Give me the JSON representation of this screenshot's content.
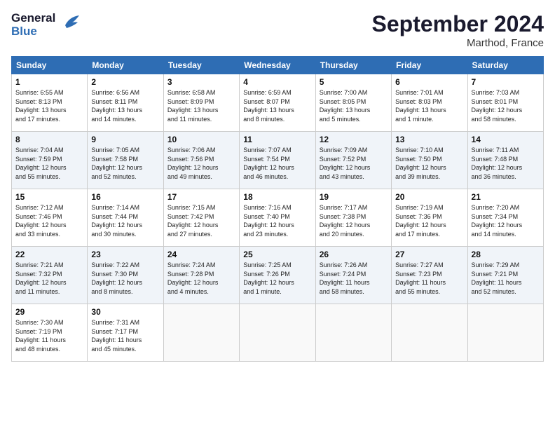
{
  "header": {
    "logo_line1": "General",
    "logo_line2": "Blue",
    "month_title": "September 2024",
    "location": "Marthod, France"
  },
  "weekdays": [
    "Sunday",
    "Monday",
    "Tuesday",
    "Wednesday",
    "Thursday",
    "Friday",
    "Saturday"
  ],
  "weeks": [
    [
      {
        "day": "1",
        "info": "Sunrise: 6:55 AM\nSunset: 8:13 PM\nDaylight: 13 hours\nand 17 minutes."
      },
      {
        "day": "2",
        "info": "Sunrise: 6:56 AM\nSunset: 8:11 PM\nDaylight: 13 hours\nand 14 minutes."
      },
      {
        "day": "3",
        "info": "Sunrise: 6:58 AM\nSunset: 8:09 PM\nDaylight: 13 hours\nand 11 minutes."
      },
      {
        "day": "4",
        "info": "Sunrise: 6:59 AM\nSunset: 8:07 PM\nDaylight: 13 hours\nand 8 minutes."
      },
      {
        "day": "5",
        "info": "Sunrise: 7:00 AM\nSunset: 8:05 PM\nDaylight: 13 hours\nand 5 minutes."
      },
      {
        "day": "6",
        "info": "Sunrise: 7:01 AM\nSunset: 8:03 PM\nDaylight: 13 hours\nand 1 minute."
      },
      {
        "day": "7",
        "info": "Sunrise: 7:03 AM\nSunset: 8:01 PM\nDaylight: 12 hours\nand 58 minutes."
      }
    ],
    [
      {
        "day": "8",
        "info": "Sunrise: 7:04 AM\nSunset: 7:59 PM\nDaylight: 12 hours\nand 55 minutes."
      },
      {
        "day": "9",
        "info": "Sunrise: 7:05 AM\nSunset: 7:58 PM\nDaylight: 12 hours\nand 52 minutes."
      },
      {
        "day": "10",
        "info": "Sunrise: 7:06 AM\nSunset: 7:56 PM\nDaylight: 12 hours\nand 49 minutes."
      },
      {
        "day": "11",
        "info": "Sunrise: 7:07 AM\nSunset: 7:54 PM\nDaylight: 12 hours\nand 46 minutes."
      },
      {
        "day": "12",
        "info": "Sunrise: 7:09 AM\nSunset: 7:52 PM\nDaylight: 12 hours\nand 43 minutes."
      },
      {
        "day": "13",
        "info": "Sunrise: 7:10 AM\nSunset: 7:50 PM\nDaylight: 12 hours\nand 39 minutes."
      },
      {
        "day": "14",
        "info": "Sunrise: 7:11 AM\nSunset: 7:48 PM\nDaylight: 12 hours\nand 36 minutes."
      }
    ],
    [
      {
        "day": "15",
        "info": "Sunrise: 7:12 AM\nSunset: 7:46 PM\nDaylight: 12 hours\nand 33 minutes."
      },
      {
        "day": "16",
        "info": "Sunrise: 7:14 AM\nSunset: 7:44 PM\nDaylight: 12 hours\nand 30 minutes."
      },
      {
        "day": "17",
        "info": "Sunrise: 7:15 AM\nSunset: 7:42 PM\nDaylight: 12 hours\nand 27 minutes."
      },
      {
        "day": "18",
        "info": "Sunrise: 7:16 AM\nSunset: 7:40 PM\nDaylight: 12 hours\nand 23 minutes."
      },
      {
        "day": "19",
        "info": "Sunrise: 7:17 AM\nSunset: 7:38 PM\nDaylight: 12 hours\nand 20 minutes."
      },
      {
        "day": "20",
        "info": "Sunrise: 7:19 AM\nSunset: 7:36 PM\nDaylight: 12 hours\nand 17 minutes."
      },
      {
        "day": "21",
        "info": "Sunrise: 7:20 AM\nSunset: 7:34 PM\nDaylight: 12 hours\nand 14 minutes."
      }
    ],
    [
      {
        "day": "22",
        "info": "Sunrise: 7:21 AM\nSunset: 7:32 PM\nDaylight: 12 hours\nand 11 minutes."
      },
      {
        "day": "23",
        "info": "Sunrise: 7:22 AM\nSunset: 7:30 PM\nDaylight: 12 hours\nand 8 minutes."
      },
      {
        "day": "24",
        "info": "Sunrise: 7:24 AM\nSunset: 7:28 PM\nDaylight: 12 hours\nand 4 minutes."
      },
      {
        "day": "25",
        "info": "Sunrise: 7:25 AM\nSunset: 7:26 PM\nDaylight: 12 hours\nand 1 minute."
      },
      {
        "day": "26",
        "info": "Sunrise: 7:26 AM\nSunset: 7:24 PM\nDaylight: 11 hours\nand 58 minutes."
      },
      {
        "day": "27",
        "info": "Sunrise: 7:27 AM\nSunset: 7:23 PM\nDaylight: 11 hours\nand 55 minutes."
      },
      {
        "day": "28",
        "info": "Sunrise: 7:29 AM\nSunset: 7:21 PM\nDaylight: 11 hours\nand 52 minutes."
      }
    ],
    [
      {
        "day": "29",
        "info": "Sunrise: 7:30 AM\nSunset: 7:19 PM\nDaylight: 11 hours\nand 48 minutes."
      },
      {
        "day": "30",
        "info": "Sunrise: 7:31 AM\nSunset: 7:17 PM\nDaylight: 11 hours\nand 45 minutes."
      },
      {
        "day": "",
        "info": ""
      },
      {
        "day": "",
        "info": ""
      },
      {
        "day": "",
        "info": ""
      },
      {
        "day": "",
        "info": ""
      },
      {
        "day": "",
        "info": ""
      }
    ]
  ]
}
